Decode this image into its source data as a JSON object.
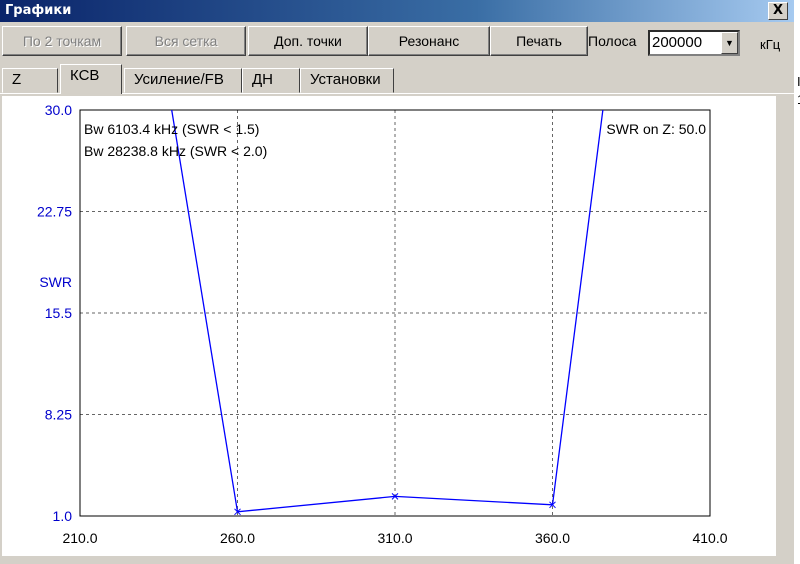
{
  "window": {
    "title": "Графики",
    "close_label": "X"
  },
  "toolbar": {
    "buttons": [
      {
        "label": "По 2 точкам",
        "enabled": false
      },
      {
        "label": "Вся сетка",
        "enabled": false
      },
      {
        "label": "Доп. точки",
        "enabled": true
      },
      {
        "label": "Резонанс",
        "enabled": true
      },
      {
        "label": "Печать",
        "enabled": true
      }
    ],
    "band_label": "Полоса",
    "band_value": "200000",
    "band_unit": "кГц"
  },
  "tabs": [
    {
      "label": "Z",
      "active": false
    },
    {
      "label": "КСВ",
      "active": true
    },
    {
      "label": "Усиление/FB",
      "active": false
    },
    {
      "label": "ДН",
      "active": false
    },
    {
      "label": "Установки",
      "active": false
    }
  ],
  "edge_glyphs": [
    "I",
    "1"
  ],
  "chart_data": {
    "type": "line",
    "ylabel": "SWR",
    "xlim": [
      210.0,
      410.0
    ],
    "ylim": [
      1.0,
      30.0
    ],
    "xticks": [
      "210.0",
      "260.0",
      "310.0",
      "360.0",
      "410.0"
    ],
    "yticks": [
      "1.0",
      "8.25",
      "15.5",
      "22.75",
      "30.0"
    ],
    "grid": true,
    "annotations": {
      "bw1": "Bw 6103.4 kHz (SWR < 1.5)",
      "bw2": "Bw 28238.8 kHz (SWR < 2.0)",
      "swr_on_z": "SWR on Z: 50.0"
    },
    "series": [
      {
        "color": "#0000ff",
        "x": [
          210.0,
          260.0,
          310.0,
          360.0,
          410.0
        ],
        "y": [
          70.0,
          1.3,
          2.4,
          1.8,
          90.0
        ]
      }
    ]
  }
}
